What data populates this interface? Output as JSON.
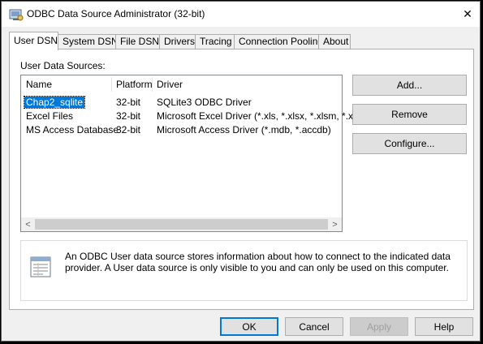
{
  "window": {
    "title": "ODBC Data Source Administrator (32-bit)",
    "close_glyph": "✕"
  },
  "tabs": [
    {
      "label": "User DSN",
      "active": true
    },
    {
      "label": "System DSN"
    },
    {
      "label": "File DSN"
    },
    {
      "label": "Drivers"
    },
    {
      "label": "Tracing"
    },
    {
      "label": "Connection Pooling"
    },
    {
      "label": "About"
    }
  ],
  "panel": {
    "group_label": "User Data Sources:",
    "columns": [
      "Name",
      "Platform",
      "Driver"
    ],
    "rows": [
      {
        "name": "Chap2_sqlite",
        "platform": "32-bit",
        "driver": "SQLite3 ODBC Driver",
        "selected": true
      },
      {
        "name": "Excel Files",
        "platform": "32-bit",
        "driver": "Microsoft Excel Driver (*.xls, *.xlsx, *.xlsm, *.xlsb)"
      },
      {
        "name": "MS Access Database",
        "platform": "32-bit",
        "driver": "Microsoft Access Driver (*.mdb, *.accdb)"
      }
    ],
    "scroll_left_glyph": "<",
    "scroll_right_glyph": ">",
    "buttons": {
      "add": "Add...",
      "remove": "Remove",
      "configure": "Configure..."
    },
    "info_text": "An ODBC User data source stores information about how to connect to the indicated data provider.   A User data source is only visible to you and can only be used on this computer."
  },
  "footer": {
    "ok": "OK",
    "cancel": "Cancel",
    "apply": "Apply",
    "help": "Help"
  },
  "colors": {
    "selection": "#0078d7",
    "default_button_border": "#0078d7"
  },
  "icons": {
    "app": "odbc-app-icon",
    "info": "data-source-document-icon"
  }
}
